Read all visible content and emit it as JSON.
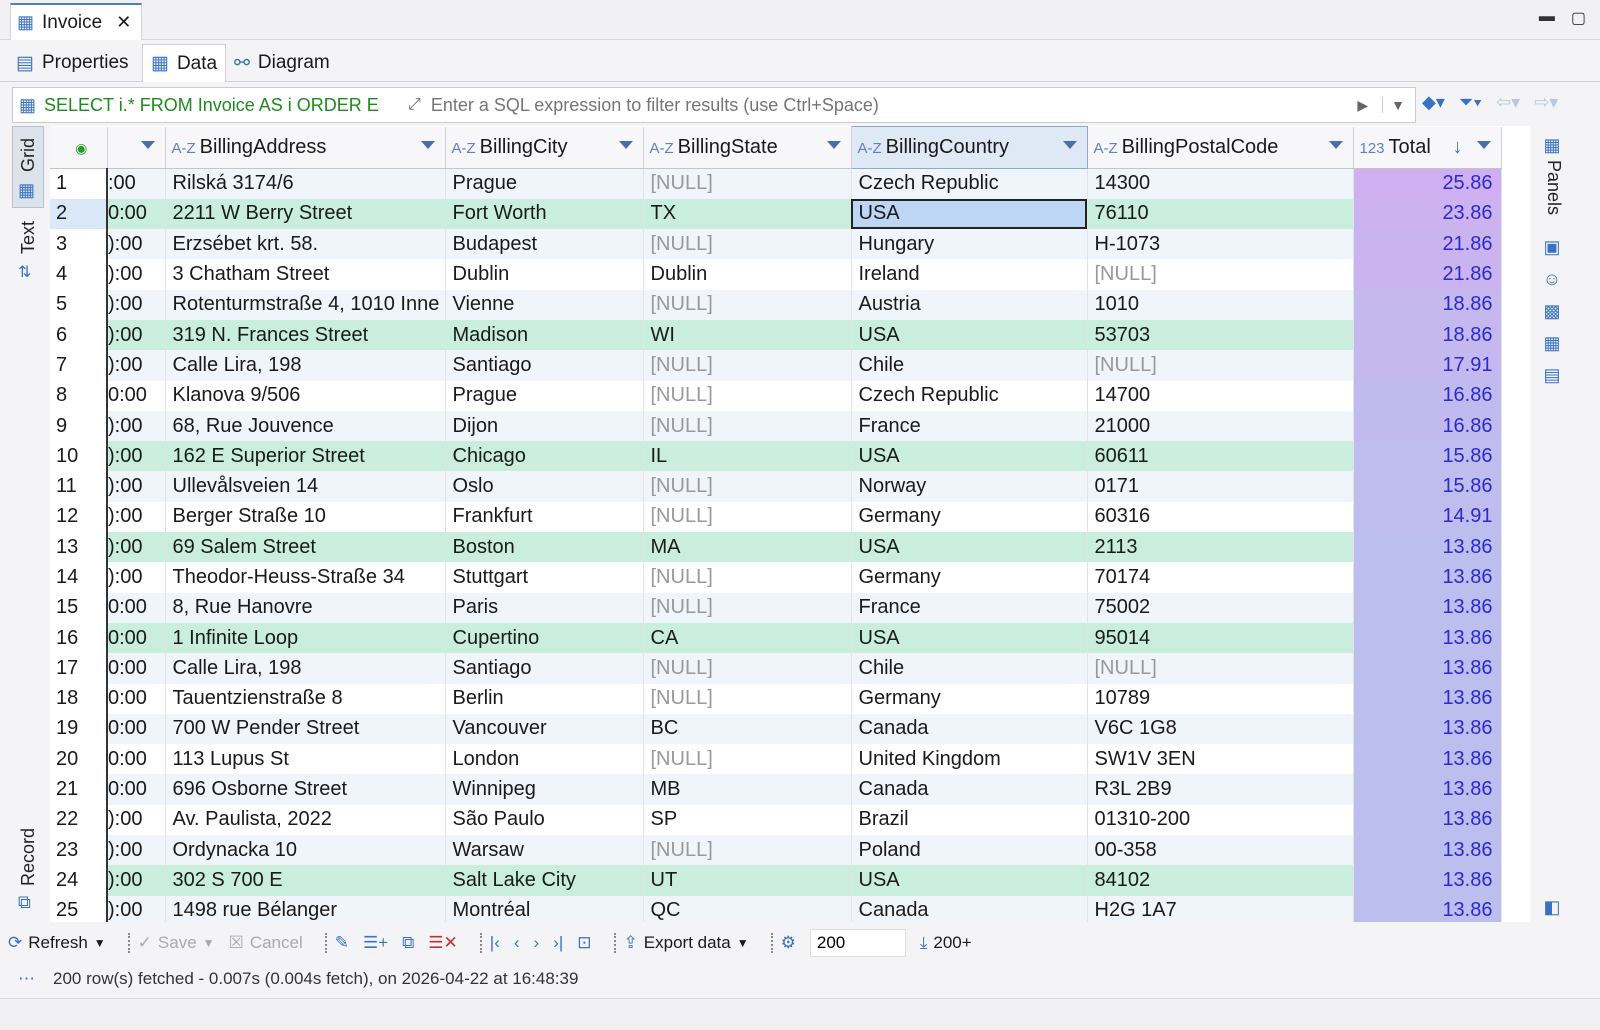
{
  "editor_tab": {
    "title": "Invoice"
  },
  "subtabs": [
    {
      "label": "Properties"
    },
    {
      "label": "Data"
    },
    {
      "label": "Diagram"
    }
  ],
  "filter": {
    "sql": "SELECT i.* FROM Invoice AS i ORDER E",
    "placeholder": "Enter a SQL expression to filter results (use Ctrl+Space)"
  },
  "left_tools": {
    "grid": "Grid",
    "text": "Text",
    "record": "Record"
  },
  "right_panel": {
    "label": "Panels"
  },
  "columns": {
    "address": "BillingAddress",
    "city": "BillingCity",
    "state": "BillingState",
    "country": "BillingCountry",
    "postal": "BillingPostalCode",
    "total": "Total",
    "az": "A-Z",
    "num": "123"
  },
  "rows": [
    {
      "n": "1",
      "t": ":00",
      "address": "Rilská 3174/6",
      "city": "Prague",
      "state": "[NULL]",
      "country": "Czech Republic",
      "postal": "14300",
      "total": "25.86"
    },
    {
      "n": "2",
      "t": "0:00",
      "address": "2211 W Berry Street",
      "city": "Fort Worth",
      "state": "TX",
      "country": "USA",
      "postal": "76110",
      "total": "23.86"
    },
    {
      "n": "3",
      "t": "):00",
      "address": "Erzsébet krt. 58.",
      "city": "Budapest",
      "state": "[NULL]",
      "country": "Hungary",
      "postal": "H-1073",
      "total": "21.86"
    },
    {
      "n": "4",
      "t": "):00",
      "address": "3 Chatham Street",
      "city": "Dublin",
      "state": "Dublin",
      "country": "Ireland",
      "postal": "[NULL]",
      "total": "21.86"
    },
    {
      "n": "5",
      "t": "):00",
      "address": "Rotenturmstraße 4, 1010 Inne",
      "city": "Vienne",
      "state": "[NULL]",
      "country": "Austria",
      "postal": "1010",
      "total": "18.86"
    },
    {
      "n": "6",
      "t": "):00",
      "address": "319 N. Frances Street",
      "city": "Madison",
      "state": "WI",
      "country": "USA",
      "postal": "53703",
      "total": "18.86"
    },
    {
      "n": "7",
      "t": "):00",
      "address": "Calle Lira, 198",
      "city": "Santiago",
      "state": "[NULL]",
      "country": "Chile",
      "postal": "[NULL]",
      "total": "17.91"
    },
    {
      "n": "8",
      "t": "0:00",
      "address": "Klanova 9/506",
      "city": "Prague",
      "state": "[NULL]",
      "country": "Czech Republic",
      "postal": "14700",
      "total": "16.86"
    },
    {
      "n": "9",
      "t": "):00",
      "address": "68, Rue Jouvence",
      "city": "Dijon",
      "state": "[NULL]",
      "country": "France",
      "postal": "21000",
      "total": "16.86"
    },
    {
      "n": "10",
      "t": "):00",
      "address": "162 E Superior Street",
      "city": "Chicago",
      "state": "IL",
      "country": "USA",
      "postal": "60611",
      "total": "15.86"
    },
    {
      "n": "11",
      "t": "):00",
      "address": "Ullevålsveien 14",
      "city": "Oslo",
      "state": "[NULL]",
      "country": "Norway",
      "postal": "0171",
      "total": "15.86"
    },
    {
      "n": "12",
      "t": "):00",
      "address": "Berger Straße 10",
      "city": "Frankfurt",
      "state": "[NULL]",
      "country": "Germany",
      "postal": "60316",
      "total": "14.91"
    },
    {
      "n": "13",
      "t": "):00",
      "address": "69 Salem Street",
      "city": "Boston",
      "state": "MA",
      "country": "USA",
      "postal": "2113",
      "total": "13.86"
    },
    {
      "n": "14",
      "t": "):00",
      "address": "Theodor-Heuss-Straße 34",
      "city": "Stuttgart",
      "state": "[NULL]",
      "country": "Germany",
      "postal": "70174",
      "total": "13.86"
    },
    {
      "n": "15",
      "t": "0:00",
      "address": "8, Rue Hanovre",
      "city": "Paris",
      "state": "[NULL]",
      "country": "France",
      "postal": "75002",
      "total": "13.86"
    },
    {
      "n": "16",
      "t": "0:00",
      "address": "1 Infinite Loop",
      "city": "Cupertino",
      "state": "CA",
      "country": "USA",
      "postal": "95014",
      "total": "13.86"
    },
    {
      "n": "17",
      "t": "0:00",
      "address": "Calle Lira, 198",
      "city": "Santiago",
      "state": "[NULL]",
      "country": "Chile",
      "postal": "[NULL]",
      "total": "13.86"
    },
    {
      "n": "18",
      "t": "0:00",
      "address": "Tauentzienstraße 8",
      "city": "Berlin",
      "state": "[NULL]",
      "country": "Germany",
      "postal": "10789",
      "total": "13.86"
    },
    {
      "n": "19",
      "t": "0:00",
      "address": "700 W Pender Street",
      "city": "Vancouver",
      "state": "BC",
      "country": "Canada",
      "postal": "V6C 1G8",
      "total": "13.86"
    },
    {
      "n": "20",
      "t": "0:00",
      "address": "113 Lupus St",
      "city": "London",
      "state": "[NULL]",
      "country": "United Kingdom",
      "postal": "SW1V 3EN",
      "total": "13.86"
    },
    {
      "n": "21",
      "t": "0:00",
      "address": "696 Osborne Street",
      "city": "Winnipeg",
      "state": "MB",
      "country": "Canada",
      "postal": "R3L 2B9",
      "total": "13.86"
    },
    {
      "n": "22",
      "t": "):00",
      "address": "Av. Paulista, 2022",
      "city": "São Paulo",
      "state": "SP",
      "country": "Brazil",
      "postal": "01310-200",
      "total": "13.86"
    },
    {
      "n": "23",
      "t": "):00",
      "address": "Ordynacka 10",
      "city": "Warsaw",
      "state": "[NULL]",
      "country": "Poland",
      "postal": "00-358",
      "total": "13.86"
    },
    {
      "n": "24",
      "t": "):00",
      "address": "302 S 700 E",
      "city": "Salt Lake City",
      "state": "UT",
      "country": "USA",
      "postal": "84102",
      "total": "13.86"
    },
    {
      "n": "25",
      "t": "):00",
      "address": "1498 rue Bélanger",
      "city": "Montréal",
      "state": "QC",
      "country": "Canada",
      "postal": "H2G 1A7",
      "total": "13.86"
    }
  ],
  "toolbar": {
    "refresh": "Refresh",
    "save": "Save",
    "cancel": "Cancel",
    "export": "Export data",
    "limit": "200",
    "count": "200+"
  },
  "status": {
    "text": "200 row(s) fetched - 0.007s (0.004s fetch), on 2026-04-22 at 16:48:39"
  },
  "colors": {
    "usa_row": "#c9eedd",
    "total_fill": "#c8b4ec",
    "total_text": "#2a2ad0",
    "selection": "#bcd6f4"
  }
}
